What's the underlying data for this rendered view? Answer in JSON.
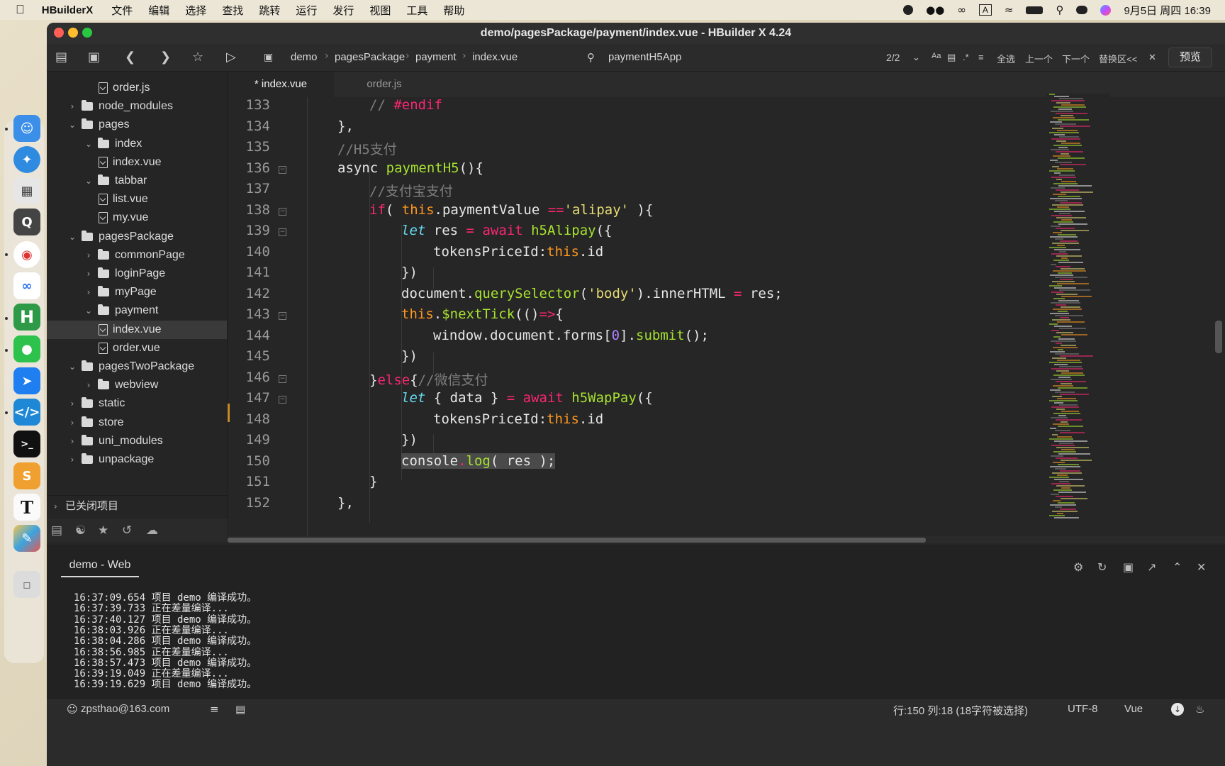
{
  "menubar": {
    "app_name": "HBuilderX",
    "items": [
      "文件",
      "编辑",
      "选择",
      "查找",
      "跳转",
      "运行",
      "发行",
      "视图",
      "工具",
      "帮助"
    ],
    "date_time": "9月5日 周四  16:39"
  },
  "window": {
    "title": "demo/pagesPackage/payment/index.vue - HBuilder X 4.24"
  },
  "toolbar": {
    "breadcrumb": [
      "demo",
      "pagesPackage",
      "payment",
      "index.vue"
    ],
    "search_text": "paymentH5App",
    "match_count": "2/2",
    "select_all": "全选",
    "prev": "上一个",
    "next": "下一个",
    "replace": "替换区<<",
    "preview": "预览"
  },
  "sidebar": {
    "rows": [
      {
        "label": "order.js",
        "type": "file",
        "depth": 3,
        "expanded": null,
        "selected": false
      },
      {
        "label": "node_modules",
        "type": "folder",
        "depth": 1,
        "expanded": false,
        "selected": false
      },
      {
        "label": "pages",
        "type": "folder",
        "depth": 1,
        "expanded": true,
        "selected": false
      },
      {
        "label": "index",
        "type": "folder",
        "depth": 2,
        "expanded": true,
        "selected": false
      },
      {
        "label": "index.vue",
        "type": "file",
        "depth": 3,
        "expanded": null,
        "selected": false
      },
      {
        "label": "tabbar",
        "type": "folder",
        "depth": 2,
        "expanded": true,
        "selected": false
      },
      {
        "label": "list.vue",
        "type": "file",
        "depth": 3,
        "expanded": null,
        "selected": false
      },
      {
        "label": "my.vue",
        "type": "file",
        "depth": 3,
        "expanded": null,
        "selected": false
      },
      {
        "label": "pagesPackage",
        "type": "folder",
        "depth": 1,
        "expanded": true,
        "selected": false
      },
      {
        "label": "commonPage",
        "type": "folder",
        "depth": 2,
        "expanded": false,
        "selected": false
      },
      {
        "label": "loginPage",
        "type": "folder",
        "depth": 2,
        "expanded": false,
        "selected": false
      },
      {
        "label": "myPage",
        "type": "folder",
        "depth": 2,
        "expanded": false,
        "selected": false
      },
      {
        "label": "payment",
        "type": "folder",
        "depth": 2,
        "expanded": true,
        "selected": false
      },
      {
        "label": "index.vue",
        "type": "file",
        "depth": 3,
        "expanded": null,
        "selected": true
      },
      {
        "label": "order.vue",
        "type": "file",
        "depth": 3,
        "expanded": null,
        "selected": false
      },
      {
        "label": "pagesTwoPackage",
        "type": "folder",
        "depth": 1,
        "expanded": true,
        "selected": false
      },
      {
        "label": "webview",
        "type": "folder",
        "depth": 2,
        "expanded": false,
        "selected": false
      },
      {
        "label": "static",
        "type": "folder",
        "depth": 1,
        "expanded": false,
        "selected": false
      },
      {
        "label": "store",
        "type": "folder",
        "depth": 1,
        "expanded": false,
        "selected": false
      },
      {
        "label": "uni_modules",
        "type": "folder",
        "depth": 1,
        "expanded": false,
        "selected": false
      },
      {
        "label": "unpackage",
        "type": "folder",
        "depth": 1,
        "expanded": false,
        "selected": false
      }
    ],
    "closed_projects": "已关闭项目"
  },
  "tabs": [
    {
      "label": "* index.vue",
      "active": true
    },
    {
      "label": "order.js",
      "active": false
    }
  ],
  "editor": {
    "lines": [
      {
        "num": "133",
        "fold": false,
        "indent": 2,
        "tokens": [
          [
            "c-cm",
            "// "
          ],
          [
            "c-dir",
            "#endif"
          ]
        ]
      },
      {
        "num": "134",
        "fold": false,
        "indent": 1,
        "tokens": [
          [
            "",
            "},"
          ]
        ]
      },
      {
        "num": "135",
        "fold": false,
        "indent": 1,
        "tokens": [
          [
            "c-cm",
            "//H5支付"
          ]
        ]
      },
      {
        "num": "136",
        "fold": true,
        "indent": 1,
        "tokens": [
          [
            "",
            "async "
          ],
          [
            "c-fn",
            "paymentH5"
          ],
          [
            "",
            "(){"
          ]
        ]
      },
      {
        "num": "137",
        "fold": false,
        "indent": 2,
        "tokens": [
          [
            "c-cm",
            "//支付宝支付"
          ]
        ]
      },
      {
        "num": "138",
        "fold": true,
        "indent": 2,
        "tokens": [
          [
            "c-kw",
            "if"
          ],
          [
            "",
            "( "
          ],
          [
            "c-this",
            "this"
          ],
          [
            "",
            ".paymentValue "
          ],
          [
            "c-kw",
            "=="
          ],
          [
            "c-str",
            "'alipay'"
          ],
          [
            "",
            " ){"
          ]
        ]
      },
      {
        "num": "139",
        "fold": true,
        "indent": 3,
        "tokens": [
          [
            "c-let",
            "let"
          ],
          [
            "",
            " res "
          ],
          [
            "c-kw",
            "="
          ],
          [
            "",
            " "
          ],
          [
            "c-kw",
            "await"
          ],
          [
            "",
            " "
          ],
          [
            "c-fn",
            "h5Alipay"
          ],
          [
            "",
            "({"
          ]
        ]
      },
      {
        "num": "140",
        "fold": false,
        "indent": 4,
        "tokens": [
          [
            "",
            "tokensPriceId:"
          ],
          [
            "c-this",
            "this"
          ],
          [
            "",
            ".id"
          ]
        ]
      },
      {
        "num": "141",
        "fold": false,
        "indent": 3,
        "tokens": [
          [
            "",
            "})"
          ]
        ]
      },
      {
        "num": "142",
        "fold": false,
        "indent": 3,
        "tokens": [
          [
            "",
            "document."
          ],
          [
            "c-fn",
            "querySelector"
          ],
          [
            "",
            "("
          ],
          [
            "c-str",
            "'body'"
          ],
          [
            "",
            ").innerHTML "
          ],
          [
            "c-kw",
            "="
          ],
          [
            "",
            " res;"
          ]
        ]
      },
      {
        "num": "143",
        "fold": true,
        "indent": 3,
        "tokens": [
          [
            "c-this",
            "this"
          ],
          [
            "",
            "."
          ],
          [
            "c-fn",
            "$nextTick"
          ],
          [
            "",
            "(()"
          ],
          [
            "c-kw",
            "=>"
          ],
          [
            "",
            "{"
          ]
        ]
      },
      {
        "num": "144",
        "fold": false,
        "indent": 4,
        "tokens": [
          [
            "",
            "window.document.forms["
          ],
          [
            "c-num",
            "0"
          ],
          [
            "",
            "]."
          ],
          [
            "c-fn",
            "submit"
          ],
          [
            "",
            "();"
          ]
        ]
      },
      {
        "num": "145",
        "fold": false,
        "indent": 3,
        "tokens": [
          [
            "",
            "})"
          ]
        ]
      },
      {
        "num": "146",
        "fold": true,
        "indent": 2,
        "tokens": [
          [
            "",
            "}"
          ],
          [
            "c-kw",
            "else"
          ],
          [
            "",
            "{"
          ],
          [
            "c-cm",
            "//微信支付"
          ]
        ]
      },
      {
        "num": "147",
        "fold": true,
        "indent": 3,
        "tokens": [
          [
            "c-let",
            "let"
          ],
          [
            "",
            " { data } "
          ],
          [
            "c-kw",
            "="
          ],
          [
            "",
            " "
          ],
          [
            "c-kw",
            "await"
          ],
          [
            "",
            " "
          ],
          [
            "c-fn",
            "h5WapPay"
          ],
          [
            "",
            "({"
          ]
        ]
      },
      {
        "num": "148",
        "fold": false,
        "indent": 4,
        "tokens": [
          [
            "",
            "tokensPriceId:"
          ],
          [
            "c-this",
            "this"
          ],
          [
            "",
            ".id"
          ]
        ]
      },
      {
        "num": "149",
        "fold": false,
        "indent": 3,
        "tokens": [
          [
            "",
            "})"
          ]
        ]
      },
      {
        "num": "150",
        "fold": false,
        "indent": 3,
        "selected": true,
        "tokens": [
          [
            "",
            "console"
          ],
          [
            "c-kw",
            "."
          ],
          [
            "c-fn",
            "log"
          ],
          [
            "",
            "( res );"
          ]
        ]
      },
      {
        "num": "151",
        "fold": false,
        "indent": 2,
        "tokens": [
          [
            "",
            "}"
          ]
        ]
      },
      {
        "num": "152",
        "fold": false,
        "indent": 1,
        "tokens": [
          [
            "",
            "},"
          ]
        ]
      }
    ]
  },
  "console": {
    "tab": "demo - Web",
    "logs": [
      "16:37:09.654 项目 demo 编译成功。",
      "16:37:39.733 正在差量编译...",
      "16:37:40.127 项目 demo 编译成功。",
      "16:38:03.926 正在差量编译...",
      "16:38:04.286 项目 demo 编译成功。",
      "16:38:56.985 正在差量编译...",
      "16:38:57.473 项目 demo 编译成功。",
      "16:39:19.049 正在差量编译...",
      "16:39:19.629 项目 demo 编译成功。"
    ]
  },
  "statusbar": {
    "user": "zpsthao@163.com",
    "position": "行:150  列:18 (18字符被选择)",
    "encoding": "UTF-8",
    "language": "Vue"
  },
  "colors": {
    "keyword": "#f92672",
    "function": "#a6e22e",
    "string": "#e6db74",
    "comment": "#7d7d7d",
    "this": "#fd971f"
  }
}
